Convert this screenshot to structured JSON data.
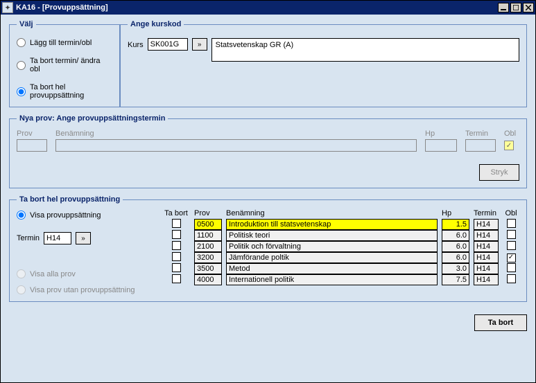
{
  "window": {
    "title": "KA16 - [Provuppsättning]"
  },
  "fieldsets": {
    "valj": {
      "legend": "Välj"
    },
    "ange": {
      "legend": "Ange kurskod"
    },
    "nyaprov": {
      "legend": "Nya prov: Ange provuppsättningstermin"
    },
    "tabort": {
      "legend": "Ta bort hel provuppsättning"
    }
  },
  "valj": {
    "opt_add": "Lägg till termin/obl",
    "opt_remove_term": "Ta bort termin/ ändra obl",
    "opt_remove_all": "Ta bort hel provuppsättning",
    "selected": "opt_remove_all"
  },
  "kurs": {
    "label": "Kurs",
    "code": "SK001G",
    "desc": "Statsvetenskap GR (A)"
  },
  "nyaprov": {
    "headers": {
      "prov": "Prov",
      "ben": "Benämning",
      "hp": "Hp",
      "termin": "Termin",
      "obl": "Obl"
    },
    "obl_checked": true,
    "btn_stryk": "Stryk"
  },
  "tabort": {
    "visa_label": "Visa provuppsättning",
    "termin_label": "Termin",
    "termin_value": "H14",
    "visa_alla": "Visa alla prov",
    "visa_utan": "Visa prov utan provuppsättning",
    "headers": {
      "tabort": "Ta bort",
      "prov": "Prov",
      "ben": "Benämning",
      "hp": "Hp",
      "termin": "Termin",
      "obl": "Obl"
    },
    "rows": [
      {
        "tb": false,
        "prov": "0500",
        "ben": "Introduktion till statsvetenskap",
        "hp": "1.5",
        "termin": "H14",
        "obl": false,
        "hl": true
      },
      {
        "tb": false,
        "prov": "1100",
        "ben": "Politisk teori",
        "hp": "6.0",
        "termin": "H14",
        "obl": false,
        "hl": false
      },
      {
        "tb": false,
        "prov": "2100",
        "ben": "Politik och förvaltning",
        "hp": "6.0",
        "termin": "H14",
        "obl": false,
        "hl": false
      },
      {
        "tb": false,
        "prov": "3200",
        "ben": "Jämförande poltik",
        "hp": "6.0",
        "termin": "H14",
        "obl": true,
        "hl": false
      },
      {
        "tb": false,
        "prov": "3500",
        "ben": "Metod",
        "hp": "3.0",
        "termin": "H14",
        "obl": false,
        "hl": false
      },
      {
        "tb": false,
        "prov": "4000",
        "ben": "Internationell politik",
        "hp": "7.5",
        "termin": "H14",
        "obl": false,
        "hl": false
      }
    ]
  },
  "footer": {
    "btn_tabort": "Ta bort"
  }
}
